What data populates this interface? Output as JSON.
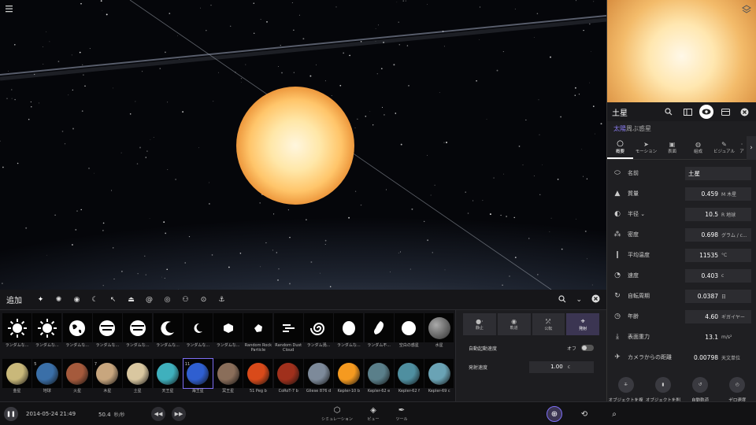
{
  "preview": {
    "layers_icon": "layers-icon"
  },
  "panel": {
    "title": "土星",
    "subtitle_link": "太陽",
    "subtitle_rest": "周ぶ惑星",
    "tabs": [
      {
        "label": "概要",
        "icon": "circle-icon"
      },
      {
        "label": "モーション",
        "icon": "motion-icon"
      },
      {
        "label": "表面",
        "icon": "image-icon"
      },
      {
        "label": "組成",
        "icon": "composition-icon"
      },
      {
        "label": "ビジュアル",
        "icon": "palette-icon"
      },
      {
        "label": "ア",
        "icon": "more-icon"
      }
    ],
    "properties": [
      {
        "label": "名前",
        "value": "土星",
        "unit": ""
      },
      {
        "label": "質量",
        "value": "0.459",
        "unit": "M 木星"
      },
      {
        "label": "半径 ⌄",
        "value": "10.5",
        "unit": "R 地球"
      },
      {
        "label": "密度",
        "value": "0.698",
        "unit": "グラム / c..."
      },
      {
        "label": "平均温度",
        "value": "11535",
        "unit": "°C"
      },
      {
        "label": "速度",
        "value": "0.403",
        "unit": "c"
      },
      {
        "label": "自転周期",
        "value": "0.0387",
        "unit": "日"
      },
      {
        "label": "年齢",
        "value": "4.60",
        "unit": "ギガイヤー"
      },
      {
        "label": "表面重力",
        "value": "13.1",
        "unit": "m/s²"
      },
      {
        "label": "カメラからの距離",
        "value": "0.00798",
        "unit": "天文単位"
      }
    ],
    "actions": [
      "オブジェクトを複製",
      "オブジェクトを削除",
      "自動軌道",
      "ゼロ速度"
    ]
  },
  "add": {
    "title": "追加",
    "categories": [
      "sparkle-icon",
      "sun-icon",
      "planet-icon",
      "moon-icon",
      "comet-icon",
      "ufo-icon",
      "galaxy-icon",
      "eye-icon",
      "people-icon",
      "target-icon",
      "anchor-icon"
    ]
  },
  "grid": {
    "row1": [
      {
        "label": "ランダムな...",
        "kind": "sun"
      },
      {
        "label": "ランダムな...",
        "kind": "sun"
      },
      {
        "label": "ランダムな...",
        "kind": "globe"
      },
      {
        "label": "ランダムな...",
        "kind": "gas"
      },
      {
        "label": "ランダムな...",
        "kind": "gas"
      },
      {
        "label": "ランダムな...",
        "kind": "moon"
      },
      {
        "label": "ランダムな...",
        "kind": "moon-s"
      },
      {
        "label": "ランダムな...",
        "kind": "hex"
      },
      {
        "label": "Random Rock Particle",
        "kind": "dot"
      },
      {
        "label": "Random Dust Cloud",
        "kind": "dust"
      },
      {
        "label": "ランダム渦...",
        "kind": "spiral"
      },
      {
        "label": "ランダムな...",
        "kind": "egg"
      },
      {
        "label": "ランダム不...",
        "kind": "bean"
      },
      {
        "label": "空白の惑星",
        "kind": "blank"
      },
      {
        "label": "水星",
        "kind": "mercury"
      }
    ],
    "row2": [
      {
        "label": "金星",
        "color": "#c9b87a",
        "idx": ""
      },
      {
        "label": "地球",
        "color": "#3a6fa8",
        "idx": "5"
      },
      {
        "label": "火星",
        "color": "#a55a3c",
        "idx": ""
      },
      {
        "label": "木星",
        "color": "#c8a67e",
        "idx": "7"
      },
      {
        "label": "土星",
        "color": "#d9c7a0",
        "idx": ""
      },
      {
        "label": "天王星",
        "color": "#3fb0bd",
        "idx": ""
      },
      {
        "label": "海王星",
        "color": "#2f5fd0",
        "idx": "11"
      },
      {
        "label": "冥王星",
        "color": "#8a6e5a",
        "idx": ""
      },
      {
        "label": "51 Peg b",
        "color": "#d94a1a",
        "idx": ""
      },
      {
        "label": "CoRoT-7 b",
        "color": "#a0301c",
        "idx": ""
      },
      {
        "label": "Gliese 876 d",
        "color": "#7d8a9a",
        "idx": ""
      },
      {
        "label": "Kepler-10 b",
        "color": "#f59a20",
        "idx": ""
      },
      {
        "label": "Kepler-62 e",
        "color": "#5a7f8a",
        "idx": ""
      },
      {
        "label": "Kepler-62 f",
        "color": "#4f8fa0",
        "idx": ""
      },
      {
        "label": "Kepler-69 c",
        "color": "#6aa3b5",
        "idx": ""
      }
    ]
  },
  "launch": {
    "modes": [
      "静止",
      "軌道",
      "公転",
      "発射"
    ],
    "auto_launch_label": "自動起動速度",
    "auto_launch_state": "オフ",
    "launch_speed_label": "発射速度",
    "launch_speed_value": "1.00",
    "launch_speed_unit": "c"
  },
  "bottom": {
    "date": "2014-05-24 21:49",
    "speed_value": "50.4",
    "speed_unit": "秒/秒",
    "tabs": [
      "シミュレーション",
      "ビュー",
      "ツール"
    ]
  }
}
